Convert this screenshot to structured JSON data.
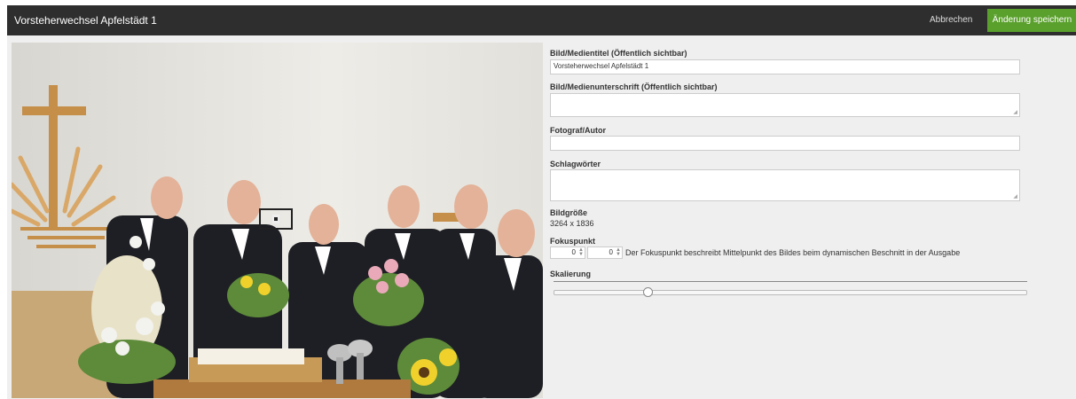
{
  "header": {
    "title": "Vorsteherwechsel Apfelstädt 1",
    "cancel_label": "Abbrechen",
    "save_label": "Änderung speichern"
  },
  "form": {
    "title_label": "Bild/Medientitel (Öffentlich sichtbar)",
    "title_value": "Vorsteherwechsel Apfelstädt 1",
    "caption_label": "Bild/Medienunterschrift (Öffentlich sichtbar)",
    "caption_value": "",
    "author_label": "Fotograf/Autor",
    "author_value": "",
    "tags_label": "Schlagwörter",
    "tags_value": "",
    "size_label": "Bildgröße",
    "size_value": "3264 x 1836",
    "focus_label": "Fokuspunkt",
    "focus_x": "0",
    "focus_y": "0",
    "focus_hint": "Der Fokuspunkt beschreibt Mittelpunkt des Bildes beim dynamischen Beschnitt in der Ausgabe",
    "scale_label": "Skalierung",
    "scale_level": 0.2
  },
  "icons": {
    "focus_marker": "focus-point-icon",
    "stepper_arrows": "spin-arrows-icon"
  },
  "colors": {
    "header_bg": "#2e2e2e",
    "save_button": "#5aa02c",
    "panel_bg": "#efefef"
  }
}
